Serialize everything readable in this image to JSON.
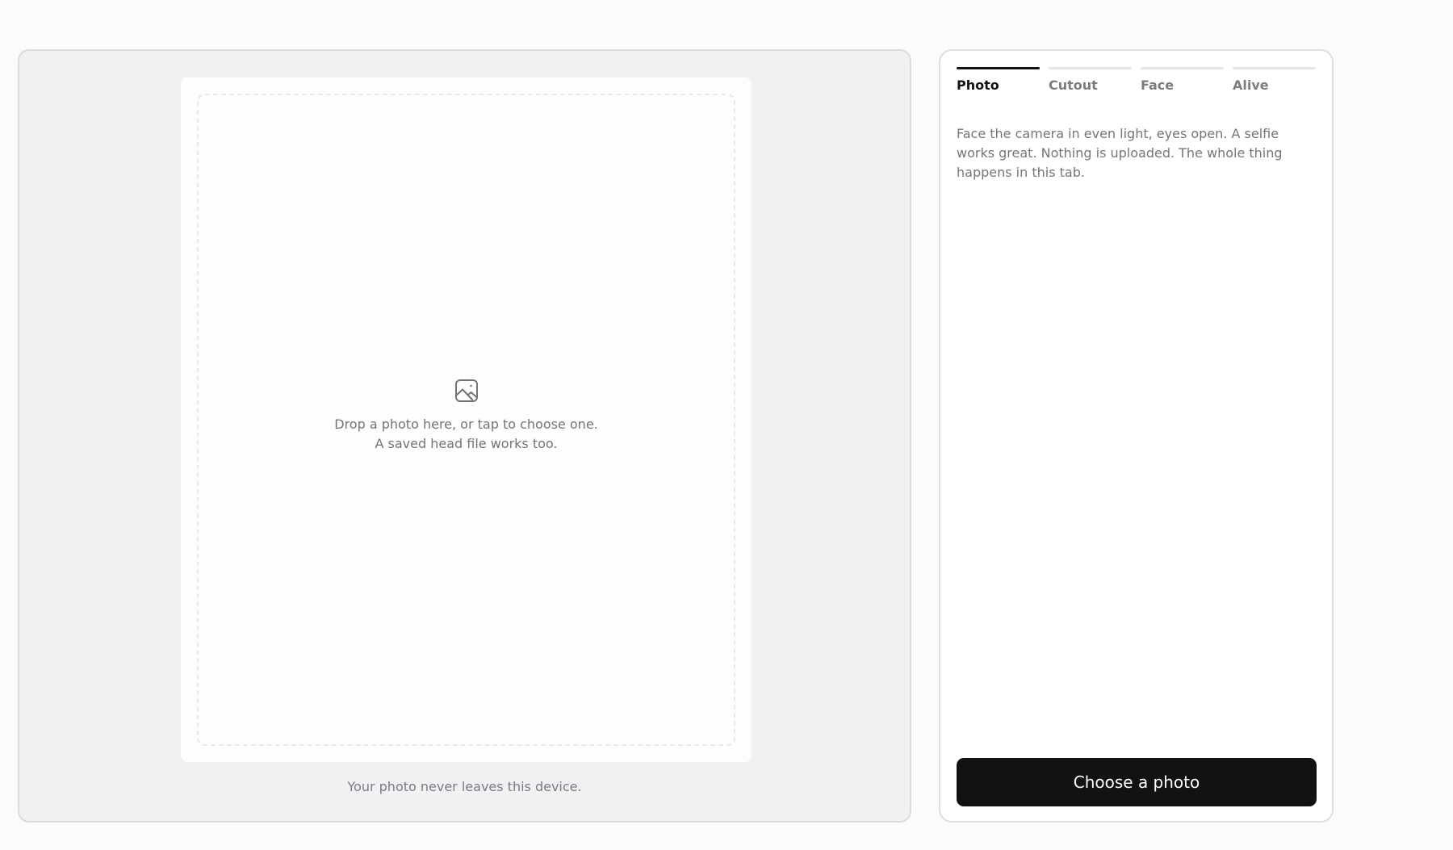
{
  "stage": {
    "dropzone": {
      "icon": "image-icon",
      "line1": "Drop a photo here, or tap to choose one.",
      "line2": "A saved head file works too."
    },
    "privacy_note": "Your photo never leaves this device."
  },
  "panel": {
    "tabs": [
      {
        "label": "Photo",
        "active": true
      },
      {
        "label": "Cutout",
        "active": false
      },
      {
        "label": "Face",
        "active": false
      },
      {
        "label": "Alive",
        "active": false
      }
    ],
    "description": "Face the camera in even light, eyes open. A selfie works great. Nothing is uploaded. The whole thing happens in this tab.",
    "choose_button": "Choose a photo"
  },
  "colors": {
    "page_background": "#fbfbfb",
    "stage_background": "#f1f1f3",
    "accent": "#111214",
    "muted_text": "#75757a",
    "tab_inactive_bar": "#e6e6e9"
  }
}
